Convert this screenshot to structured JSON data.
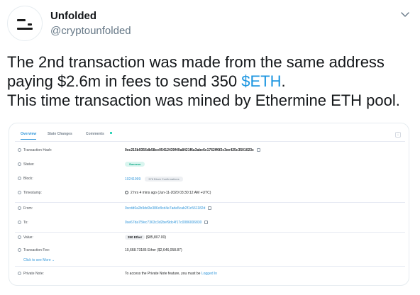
{
  "user": {
    "name": "Unfolded",
    "handle": "@cryptounfolded"
  },
  "tweet": {
    "line1": "The 2nd transaction was made from the same address",
    "line2_pre": "paying $2.6m in fees to send 350 ",
    "line2_cashtag": "$ETH",
    "line2_post": ".",
    "line3": "This time transaction was mined by Ethermine ETH pool."
  },
  "colors": {
    "accent": "#1b95e0",
    "etherscan_link": "#3498db",
    "success": "#00a57f"
  },
  "etherscan": {
    "tabs": [
      "Overview",
      "State Changes",
      "Comments"
    ],
    "menu_label": "⋮",
    "tx_hash": {
      "label": "Transaction Hash:",
      "value": "0xc215b9356db58ce05412439f49a8421f6a3abe6c1762ff6f2c3ee425c3501023c"
    },
    "status": {
      "label": "Status:",
      "value": "Success"
    },
    "block": {
      "label": "Block:",
      "value": "10241999",
      "confirmations": "376 Block Confirmations"
    },
    "timestamp": {
      "label": "Timestamp:",
      "value": "2 hrs 4 mins ago (Jun-11-2020 03:30:12 AM +UTC)"
    },
    "from": {
      "label": "From:",
      "value": "0xcdd6a2b9dd3e386c8cd4e7ada5cab2f1c561182d"
    },
    "to": {
      "label": "To:",
      "value": "0xe67da75fec7363c3d2bef9dc4f17c0086006830"
    },
    "value": {
      "label": "Value:",
      "eth": "350 Ether",
      "usd": "($85,807.00)"
    },
    "fee": {
      "label": "Transaction Fee:",
      "value": "10,668.73185 Ether ($2,646,058.87)"
    },
    "see_more": "Click to see More",
    "private_note": {
      "label": "Private Note:",
      "value_pre": "To access the Private Note feature, you must be ",
      "value_link": "Logged In"
    }
  },
  "icons": {
    "chevron": "chevron-down-icon",
    "question": "question-circle-icon",
    "copy": "copy-icon",
    "clock": "clock-icon"
  }
}
